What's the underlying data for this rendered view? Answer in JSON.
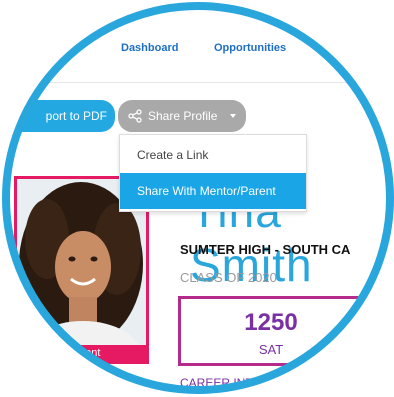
{
  "nav": {
    "dashboard": "Dashboard",
    "opportunities": "Opportunities"
  },
  "toolbar": {
    "export_label": "port to PDF",
    "share_label": "Share Profile"
  },
  "share_menu": {
    "items": [
      "Create a Link",
      "Share With Mentor/Parent"
    ],
    "selected_index": 1
  },
  "profile": {
    "name": "Tina Smith",
    "school": "SUMTER HIGH - SOUTH CA",
    "class_of": "CLASS OF 2020",
    "photo_caption": "Student",
    "score_value": "1250",
    "score_label": "SAT",
    "career_heading": "CAREER INTE"
  },
  "colors": {
    "ring": "#29a6dc",
    "accent_blue": "#23a8e2",
    "highlight": "#1aa5e6",
    "magenta": "#e51a63",
    "purple": "#7a2fa4"
  },
  "icons": [
    "share-icon",
    "caret-down-icon"
  ]
}
